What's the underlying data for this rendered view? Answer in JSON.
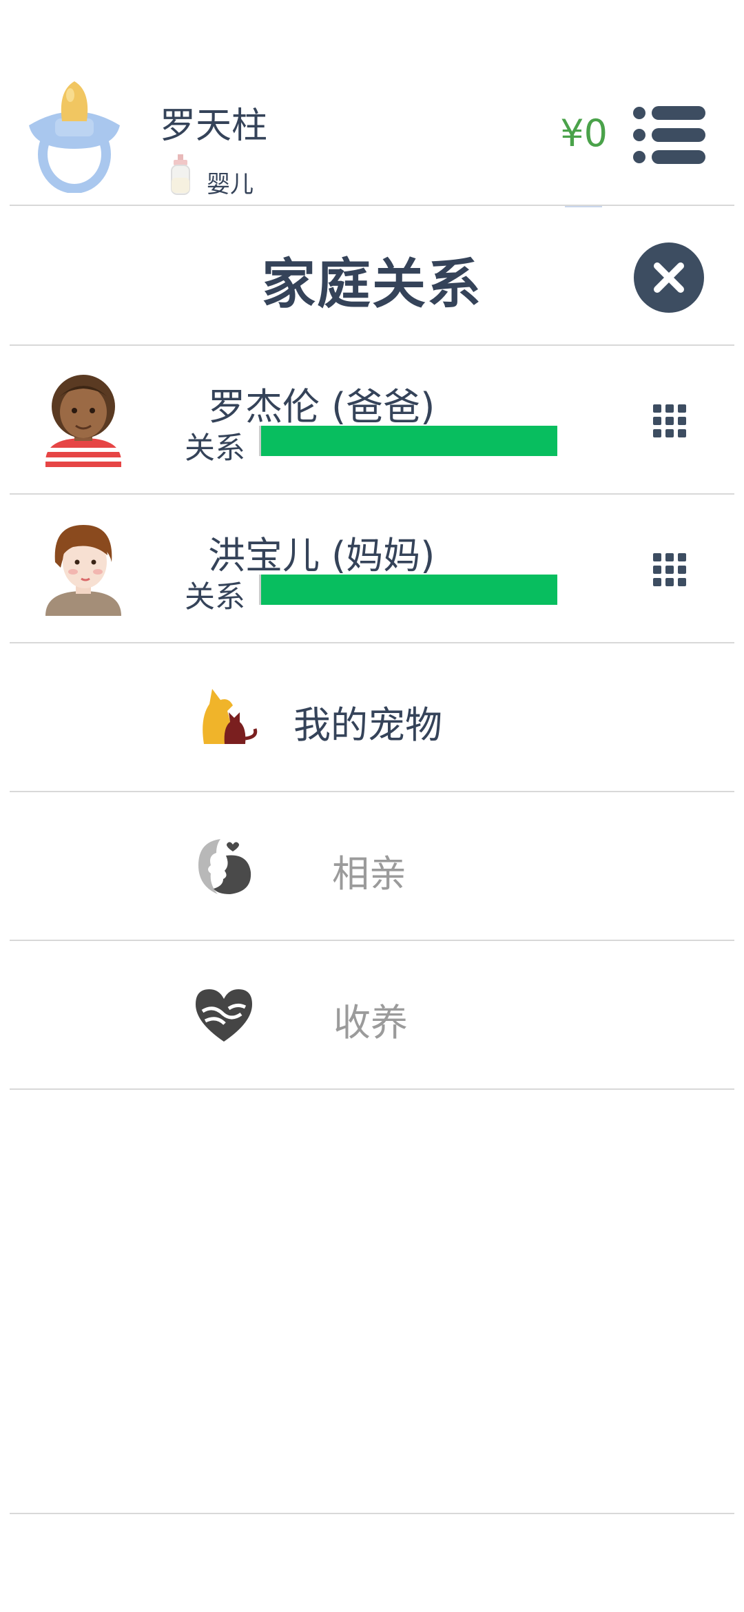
{
  "header": {
    "player_name": "罗天柱",
    "life_stage": "婴儿",
    "money": "¥0",
    "avatar_icon": "pacifier-icon",
    "stage_icon": "baby-bottle-icon",
    "menu_icon": "menu-list-icon"
  },
  "modal": {
    "title": "家庭关系",
    "close_icon": "close-icon"
  },
  "relations": [
    {
      "name": "罗杰伦 (爸爸)",
      "label": "关系",
      "relationship_level": 1.0,
      "avatar": "father-avatar",
      "options_icon": "grid-icon"
    },
    {
      "name": "洪宝儿 (妈妈)",
      "label": "关系",
      "relationship_level": 1.0,
      "avatar": "mother-avatar",
      "options_icon": "grid-icon"
    }
  ],
  "actions": [
    {
      "label": "我的宠物",
      "icon": "pet-icon",
      "enabled": true
    },
    {
      "label": "相亲",
      "icon": "dating-icon",
      "enabled": false
    },
    {
      "label": "收养",
      "icon": "adopt-heart-icon",
      "enabled": false
    }
  ],
  "colors": {
    "text_dark": "#354359",
    "money_green": "#4aa24a",
    "bar_green": "#08be5f",
    "disabled_gray": "#9b9b9b",
    "close_bg": "#3d4d61"
  }
}
